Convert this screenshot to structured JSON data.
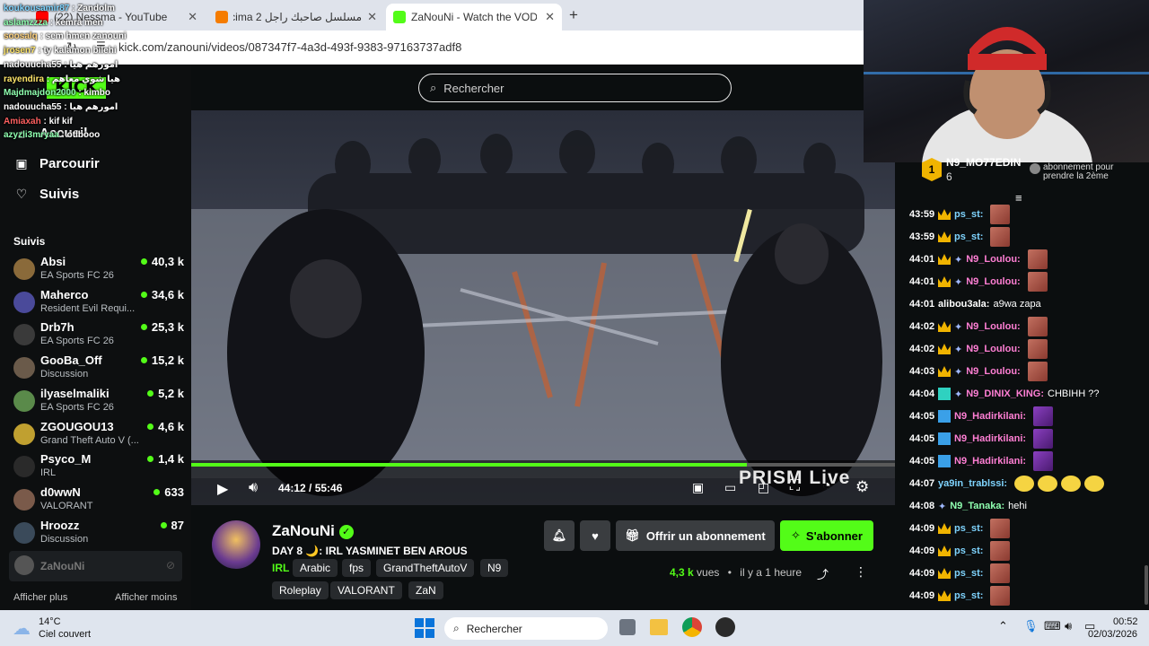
{
  "browser": {
    "tabs": [
      {
        "label": "(22) Nessma - YouTube",
        "color": "#ff0000"
      },
      {
        "label": "مسلسل صاحبك راجل 2 atch cima",
        "color": "#f57c00"
      },
      {
        "label": "ZaNouNi - Watch the VOD on K",
        "color": "#53fc18"
      }
    ],
    "url": "kick.com/zanouni/videos/087347f7-4a3d-493f-9383-97163737adf8"
  },
  "overlay_chat": [
    {
      "user": "koukousamir87",
      "msg": ": Zandolm",
      "color": "#7fd4ff"
    },
    {
      "user": "aslamzzza",
      "msg": ": kemra men",
      "color": "#8fffb0"
    },
    {
      "user": "soosalq",
      "msg": ": sem hmen zanouni",
      "color": "#ffd37f"
    },
    {
      "user": "jrosen7",
      "msg": ": ty kalamon bilehi",
      "color": "#ffe66a"
    },
    {
      "user": "nadouucha55",
      "msg": ": امورهم هيا",
      "color": "#ffffff"
    },
    {
      "user": "rayendira",
      "msg": ": هيا شوي معاهم",
      "color": "#ffe66a"
    },
    {
      "user": "Majdmajdon2000",
      "msg": ": kimbo",
      "color": "#8fffb0"
    },
    {
      "user": "nadouucha55",
      "msg": ": امورهم هيا",
      "color": "#ffffff"
    },
    {
      "user": "Amiaxah",
      "msg": ": kif kif",
      "color": "#ff6060"
    },
    {
      "user": "azyzli3mryaa",
      "msg": ": otlbooo",
      "color": "#8fffb0"
    }
  ],
  "nav": {
    "home": "Accueil",
    "browse": "Parcourir",
    "following": "Suivis"
  },
  "sidebar": {
    "section": "Suivis",
    "follows": [
      {
        "name": "Absi",
        "game": "EA Sports FC 26",
        "viewers": "40,3 k",
        "avatar": "#8a6a3a"
      },
      {
        "name": "Maherco",
        "game": "Resident Evil Requi...",
        "viewers": "34,6 k",
        "avatar": "#4a4a9a"
      },
      {
        "name": "Drb7h",
        "game": "EA Sports FC 26",
        "viewers": "25,3 k",
        "avatar": "#3a3a3a"
      },
      {
        "name": "GooBa_Off",
        "game": "Discussion",
        "viewers": "15,2 k",
        "avatar": "#6a5a4a"
      },
      {
        "name": "ilyaselmaliki",
        "game": "EA Sports FC 26",
        "viewers": "5,2 k",
        "avatar": "#5a8a4a"
      },
      {
        "name": "ZGOUGOU13",
        "game": "Grand Theft Auto V (...",
        "viewers": "4,6 k",
        "avatar": "#c0a030"
      },
      {
        "name": "Psyco_M",
        "game": "IRL",
        "viewers": "1,4 k",
        "avatar": "#2a2a2a"
      },
      {
        "name": "d0wwN",
        "game": "VALORANT",
        "viewers": "633",
        "avatar": "#7a5a4a"
      },
      {
        "name": "Hroozz",
        "game": "Discussion",
        "viewers": "87",
        "avatar": "#3a4a5a"
      }
    ],
    "offline": "ZaNouNi",
    "show_more": "Afficher plus",
    "show_less": "Afficher moins"
  },
  "search": {
    "placeholder": "Rechercher"
  },
  "player": {
    "time": "44:12 / 55:46",
    "progress": 0.79,
    "watermark": "PRISM Live"
  },
  "channel": {
    "name": "ZaNouNi",
    "title": "DAY 8 🌙: IRL YASMINET BEN AROUS",
    "tags": [
      "IRL",
      "Arabic",
      "fps",
      "GrandTheftAutoV",
      "N9",
      "Roleplay",
      "VALORANT",
      "ZaN"
    ],
    "gift": "Offrir un abonnement",
    "subscribe": "S'abonner",
    "views": "4,3 k",
    "views_label": "vues",
    "ago": "il y a 1 heure"
  },
  "chat": {
    "pinned_user": "N9_MO77EDIN",
    "pinned_count": "6",
    "pinned_rank": "1",
    "sub_text": "abonnement pour prendre la 2ème",
    "lines": [
      {
        "t": "43:59",
        "u": "ps_st:",
        "c": "#7fd4ff",
        "e": "emote",
        "b": "crown",
        "msg": ""
      },
      {
        "t": "43:59",
        "u": "ps_st:",
        "c": "#7fd4ff",
        "e": "emote",
        "b": "crown",
        "msg": ""
      },
      {
        "t": "44:01",
        "u": "N9_Loulou:",
        "c": "#ff7fd4",
        "e": "emote",
        "b": "crown2",
        "msg": ""
      },
      {
        "t": "44:01",
        "u": "N9_Loulou:",
        "c": "#ff7fd4",
        "e": "emote",
        "b": "crown2",
        "msg": ""
      },
      {
        "t": "44:01",
        "u": "alibou3ala:",
        "c": "#ffffff",
        "e": "",
        "b": "",
        "msg": "a9wa zapa"
      },
      {
        "t": "44:02",
        "u": "N9_Loulou:",
        "c": "#ff7fd4",
        "e": "emote",
        "b": "crown2",
        "msg": ""
      },
      {
        "t": "44:02",
        "u": "N9_Loulou:",
        "c": "#ff7fd4",
        "e": "emote",
        "b": "crown2",
        "msg": ""
      },
      {
        "t": "44:03",
        "u": "N9_Loulou:",
        "c": "#ff7fd4",
        "e": "emote",
        "b": "crown2",
        "msg": ""
      },
      {
        "t": "44:04",
        "u": "N9_DINIX_KING:",
        "c": "#ff7fd4",
        "e": "",
        "b": "crown3",
        "msg": "CHBIHH ??"
      },
      {
        "t": "44:05",
        "u": "N9_Hadirkilani:",
        "c": "#ff7fd4",
        "e": "purple",
        "b": "tag",
        "msg": ""
      },
      {
        "t": "44:05",
        "u": "N9_Hadirkilani:",
        "c": "#ff7fd4",
        "e": "purple",
        "b": "tag",
        "msg": ""
      },
      {
        "t": "44:05",
        "u": "N9_Hadirkilani:",
        "c": "#ff7fd4",
        "e": "purple",
        "b": "tag",
        "msg": ""
      },
      {
        "t": "44:07",
        "u": "ya9in_trablssi:",
        "c": "#7fd4ff",
        "e": "yellow",
        "b": "",
        "msg": ""
      },
      {
        "t": "44:08",
        "u": "N9_Tanaka:",
        "c": "#8fffb0",
        "e": "",
        "b": "n9",
        "msg": "hehi"
      },
      {
        "t": "44:09",
        "u": "ps_st:",
        "c": "#7fd4ff",
        "e": "emote",
        "b": "crown",
        "msg": ""
      },
      {
        "t": "44:09",
        "u": "ps_st:",
        "c": "#7fd4ff",
        "e": "emote",
        "b": "crown",
        "msg": ""
      },
      {
        "t": "44:09",
        "u": "ps_st:",
        "c": "#7fd4ff",
        "e": "emote",
        "b": "crown",
        "msg": ""
      },
      {
        "t": "44:09",
        "u": "ps_st:",
        "c": "#7fd4ff",
        "e": "emote",
        "b": "crown",
        "msg": ""
      }
    ]
  },
  "taskbar": {
    "weather_temp": "14°C",
    "weather_desc": "Ciel couvert",
    "search": "Rechercher",
    "time": "00:52",
    "date": "02/03/2026"
  }
}
